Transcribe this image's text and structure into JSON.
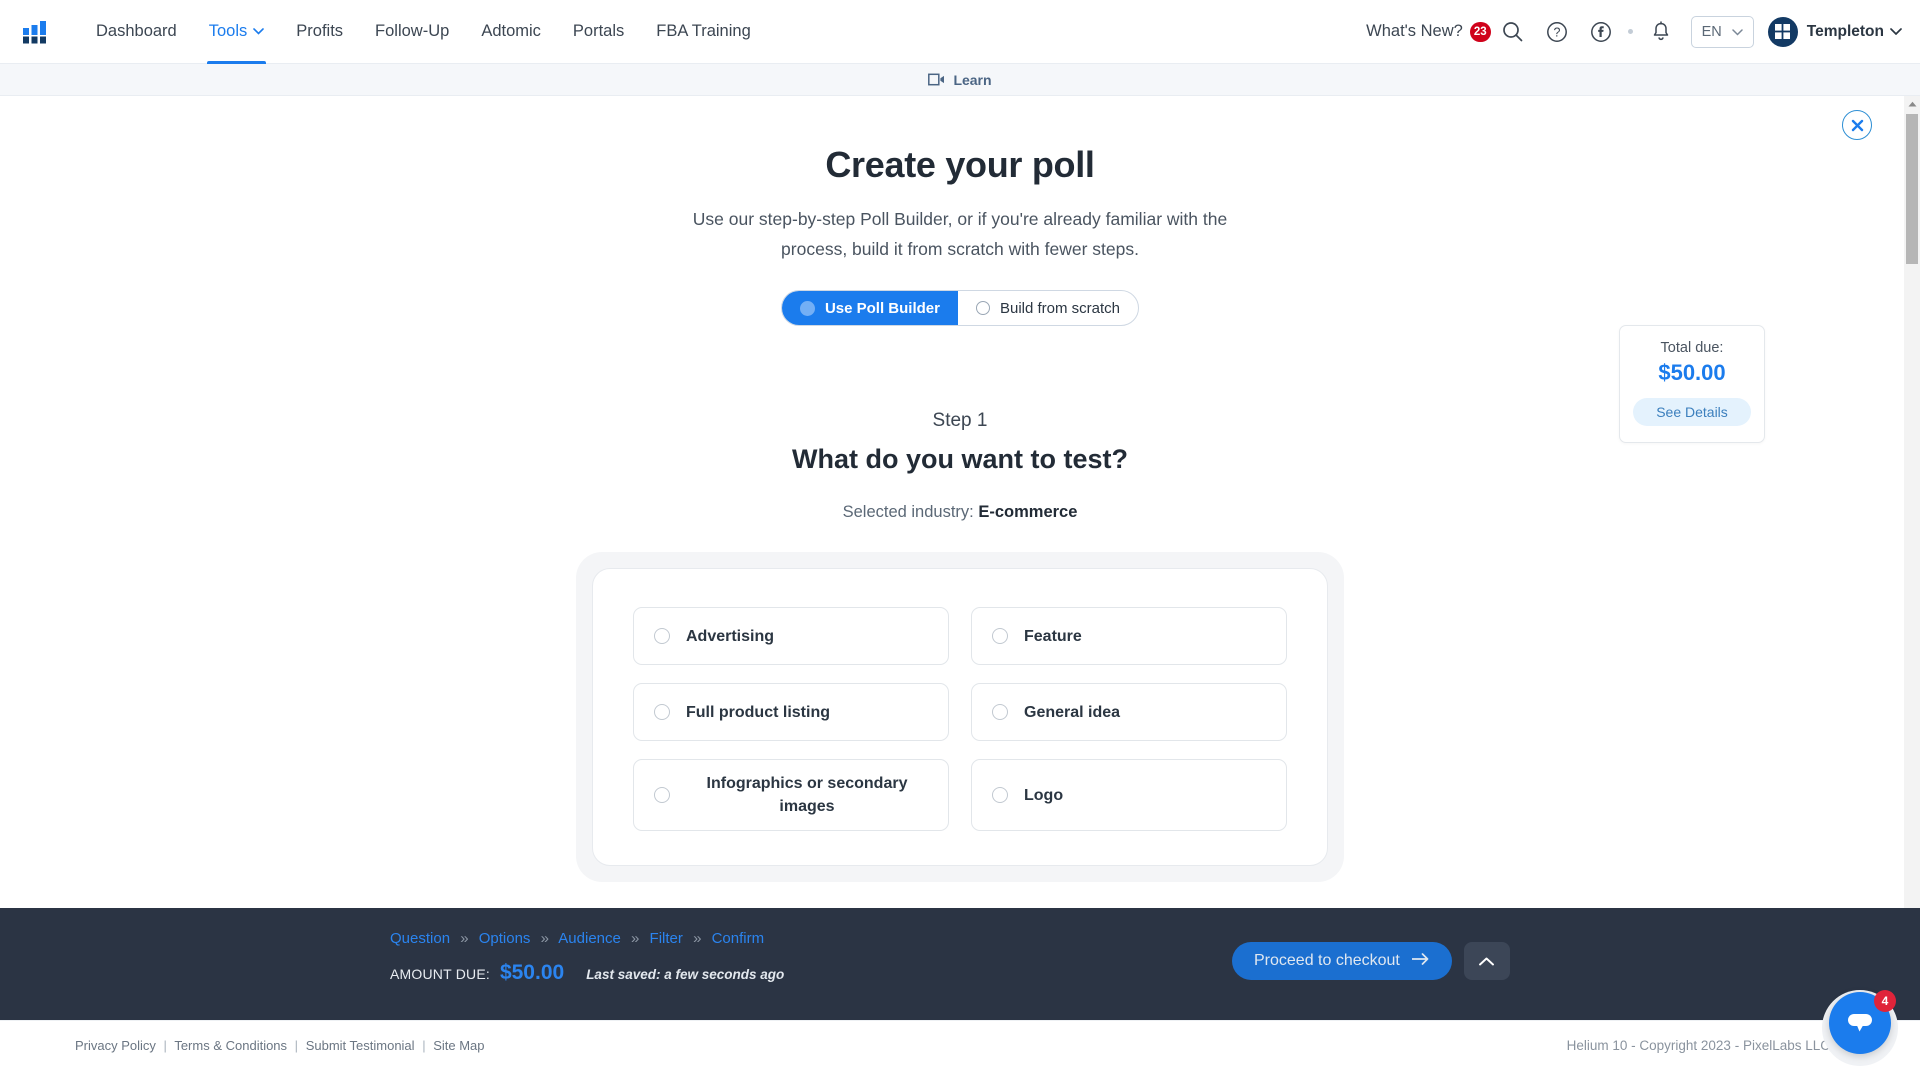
{
  "nav": {
    "logo_name": "helium10-logo",
    "links": [
      {
        "label": "Dashboard",
        "active": false,
        "has_caret": false
      },
      {
        "label": "Tools",
        "active": true,
        "has_caret": true
      },
      {
        "label": "Profits",
        "active": false,
        "has_caret": false
      },
      {
        "label": "Follow-Up",
        "active": false,
        "has_caret": false
      },
      {
        "label": "Adtomic",
        "active": false,
        "has_caret": false
      },
      {
        "label": "Portals",
        "active": false,
        "has_caret": false
      },
      {
        "label": "FBA Training",
        "active": false,
        "has_caret": false
      }
    ],
    "whats_new_label": "What's New?",
    "whats_new_count": "23",
    "language": "EN",
    "user_name": "Templeton"
  },
  "learnbar": {
    "label": "Learn"
  },
  "hero": {
    "title": "Create your poll",
    "subtitle": "Use our step-by-step Poll Builder, or if you're already familiar with the process, build it from scratch with fewer steps.",
    "toggle": [
      {
        "label": "Use Poll Builder",
        "selected": true
      },
      {
        "label": "Build from scratch",
        "selected": false
      }
    ]
  },
  "step": {
    "step_label": "Step 1",
    "question": "What do you want to test?",
    "industry_prefix": "Selected industry:",
    "industry_value": "E-commerce",
    "options": [
      {
        "label": "Advertising",
        "selected": false
      },
      {
        "label": "Feature",
        "selected": false
      },
      {
        "label": "Full product listing",
        "selected": false
      },
      {
        "label": "General idea",
        "selected": false
      },
      {
        "label": "Infographics or secondary images",
        "selected": false
      },
      {
        "label": "Logo",
        "selected": false
      }
    ]
  },
  "total_panel": {
    "label": "Total due:",
    "amount": "$50.00",
    "button": "See Details"
  },
  "bottom_bar": {
    "breadcrumbs": [
      "Question",
      "Options",
      "Audience",
      "Filter",
      "Confirm"
    ],
    "separator": "»",
    "amount_label": "AMOUNT DUE:",
    "amount_value": "$50.00",
    "saved_text": "Last saved: a few seconds ago",
    "checkout_label": "Proceed to checkout",
    "collapse_name": "chevron-up-icon"
  },
  "footer": {
    "links": [
      "Privacy Policy",
      "Terms & Conditions",
      "Submit Testimonial",
      "Site Map"
    ],
    "separator": "|",
    "copyright": "Helium 10 - Copyright 2023 - PixelLabs LLC"
  },
  "chat": {
    "badge": "4"
  },
  "colors": {
    "accent_blue": "#1b7ced",
    "dark_bar": "#2b3444",
    "badge_red": "#d0021b",
    "navy": "#133a64"
  }
}
